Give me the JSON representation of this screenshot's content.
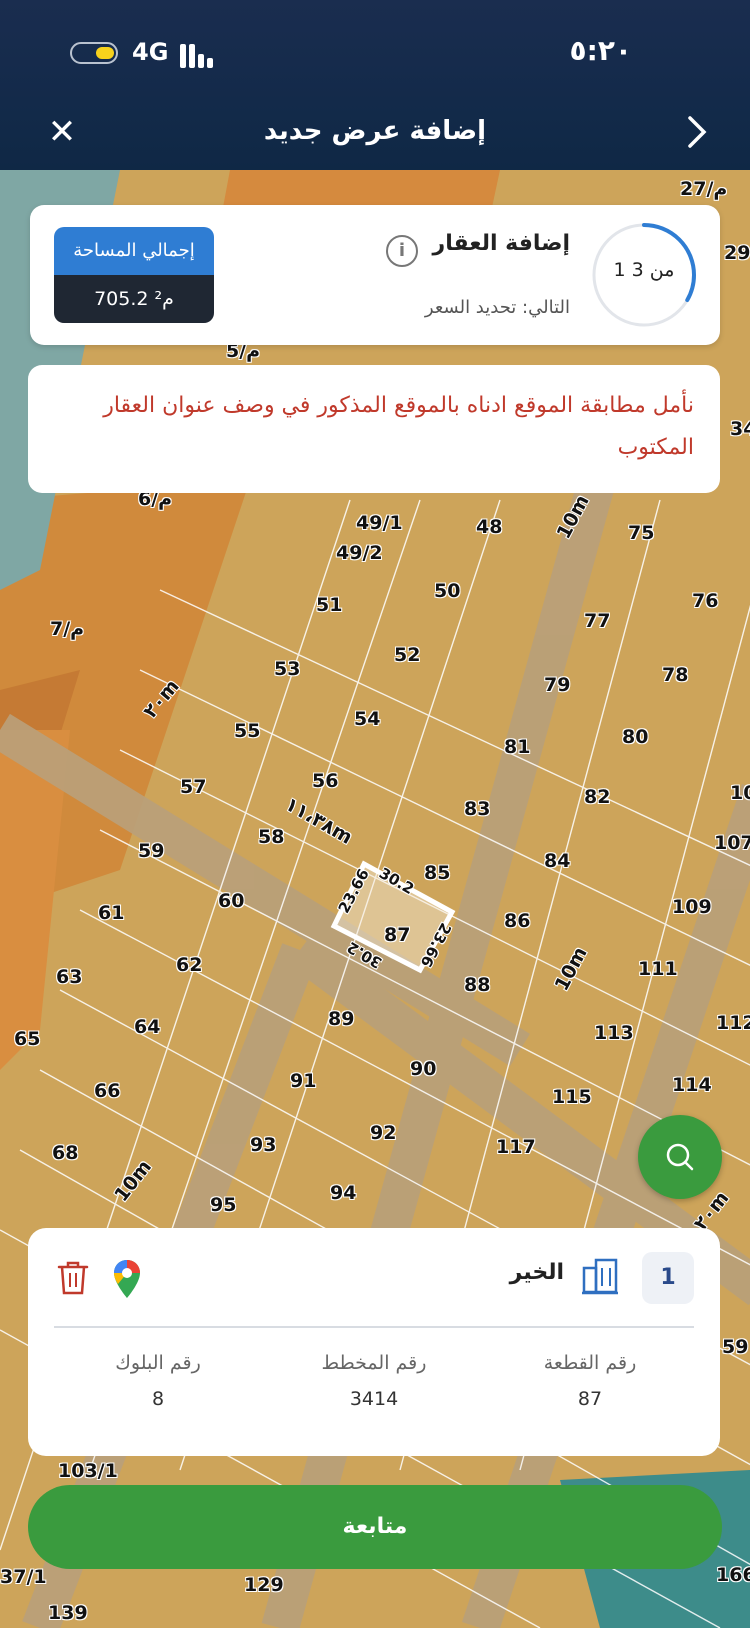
{
  "status_bar": {
    "time": "٥:٢٠",
    "network": "4G"
  },
  "header": {
    "title": "إضافة عرض جديد",
    "close_icon": "close-icon",
    "back_icon": "chevron-right-icon"
  },
  "step": {
    "progress_text": "1 من 3",
    "progress_fraction": 0.333,
    "title": "إضافة العقار",
    "next": "التالي: تحديد السعر",
    "area_label": "إجمالي المساحة",
    "area_value": "705.2 م²"
  },
  "notice": "نأمل مطابقة الموقع ادناه بالموقع المذكور في وصف عنوان العقار المكتوب",
  "map": {
    "labels": [
      "27/م",
      "49/1",
      "49/2",
      "48",
      "75",
      "76",
      "77",
      "78",
      "79",
      "80",
      "81",
      "82",
      "83",
      "84",
      "85",
      "86",
      "87",
      "88",
      "89",
      "90",
      "91",
      "92",
      "93",
      "94",
      "95",
      "50",
      "51",
      "52",
      "53",
      "54",
      "55",
      "56",
      "57",
      "58",
      "59",
      "60",
      "61",
      "62",
      "63",
      "64",
      "65",
      "66",
      "68",
      "107",
      "109",
      "111",
      "112",
      "113",
      "114",
      "115",
      "117",
      "10m",
      "10m",
      "٢٠m",
      "١١،٣٨m",
      "٢٠m",
      "10m",
      "30.2",
      "30.2",
      "23.66",
      "23.66",
      "103/1",
      "129",
      "139",
      "59",
      "37/1",
      "166",
      "م/6",
      "م/7",
      "م/5",
      "29",
      "34",
      "10"
    ]
  },
  "plot": {
    "index": "1",
    "district": "الخير",
    "parcel_label": "رقم  القطعة",
    "parcel_value": "87",
    "plan_label": "رقم المخطط",
    "plan_value": "3414",
    "block_label": "رقم  البلوك",
    "block_value": "8"
  },
  "continue_label": "متابعة",
  "colors": {
    "accent_blue": "#2f7dd3",
    "green": "#3a9b3e",
    "notice_red": "#c0392b",
    "navy": "#132a4a"
  }
}
